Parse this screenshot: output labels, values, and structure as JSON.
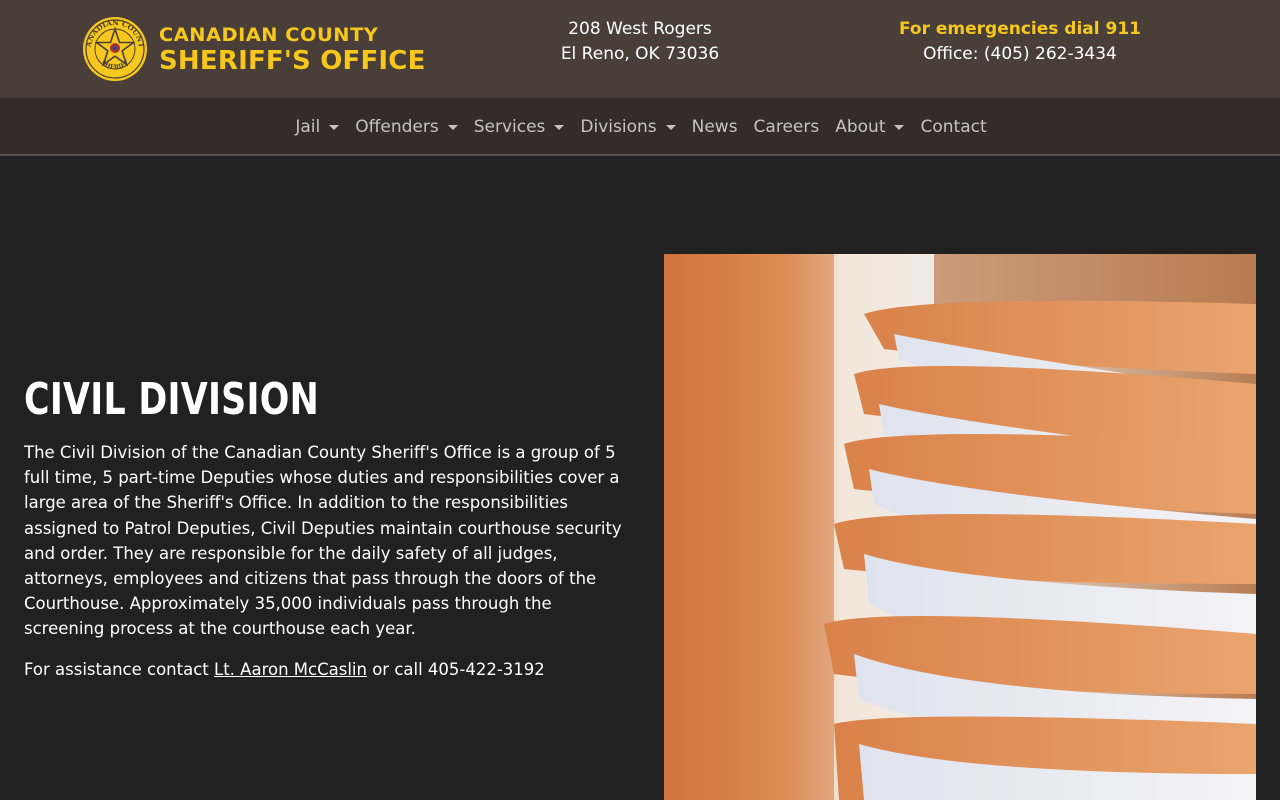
{
  "header": {
    "logo": {
      "line1": "Canadian County",
      "line2": "Sheriff's Office",
      "badge_text_top": "CANADIAN COUNTY",
      "badge_text_bottom": "SHERIFF"
    },
    "address": {
      "line1": "208 West Rogers",
      "line2": "El Reno, OK 73036"
    },
    "contact": {
      "emergency": "For emergencies dial 911",
      "office": "Office: (405) 262-3434"
    }
  },
  "nav": {
    "items": [
      {
        "label": "Jail",
        "dropdown": true
      },
      {
        "label": "Offenders",
        "dropdown": true
      },
      {
        "label": "Services",
        "dropdown": true
      },
      {
        "label": "Divisions",
        "dropdown": true
      },
      {
        "label": "News",
        "dropdown": false
      },
      {
        "label": "Careers",
        "dropdown": false
      },
      {
        "label": "About",
        "dropdown": true
      },
      {
        "label": "Contact",
        "dropdown": false
      }
    ]
  },
  "main": {
    "title": "CIVIL DIVISION",
    "paragraph": "The Civil Division of the Canadian County Sheriff's Office is a group of 5 full time, 5 part-time Deputies whose duties and responsibilities cover a large area of the Sheriff's Office. In addition to the responsibilities assigned to Patrol Deputies, Civil Deputies maintain courthouse security and order. They are responsible for the daily safety of all judges, attorneys, employees and citizens that pass through the doors of the Courthouse. Approximately 35,000 individuals pass through the screening process at the courthouse each year.",
    "assistance_prefix": "For assistance contact ",
    "assistance_link": "Lt. Aaron McCaslin",
    "assistance_suffix": " or call 405-422-3192"
  },
  "colors": {
    "header_bg": "#4a3e39",
    "nav_bg": "#352c29",
    "page_bg": "#212121",
    "accent_gold": "#f6c81d",
    "nav_text": "#c9c2bd"
  },
  "icons": {
    "badge": "sheriff-star-badge",
    "caret": "chevron-down-icon"
  }
}
